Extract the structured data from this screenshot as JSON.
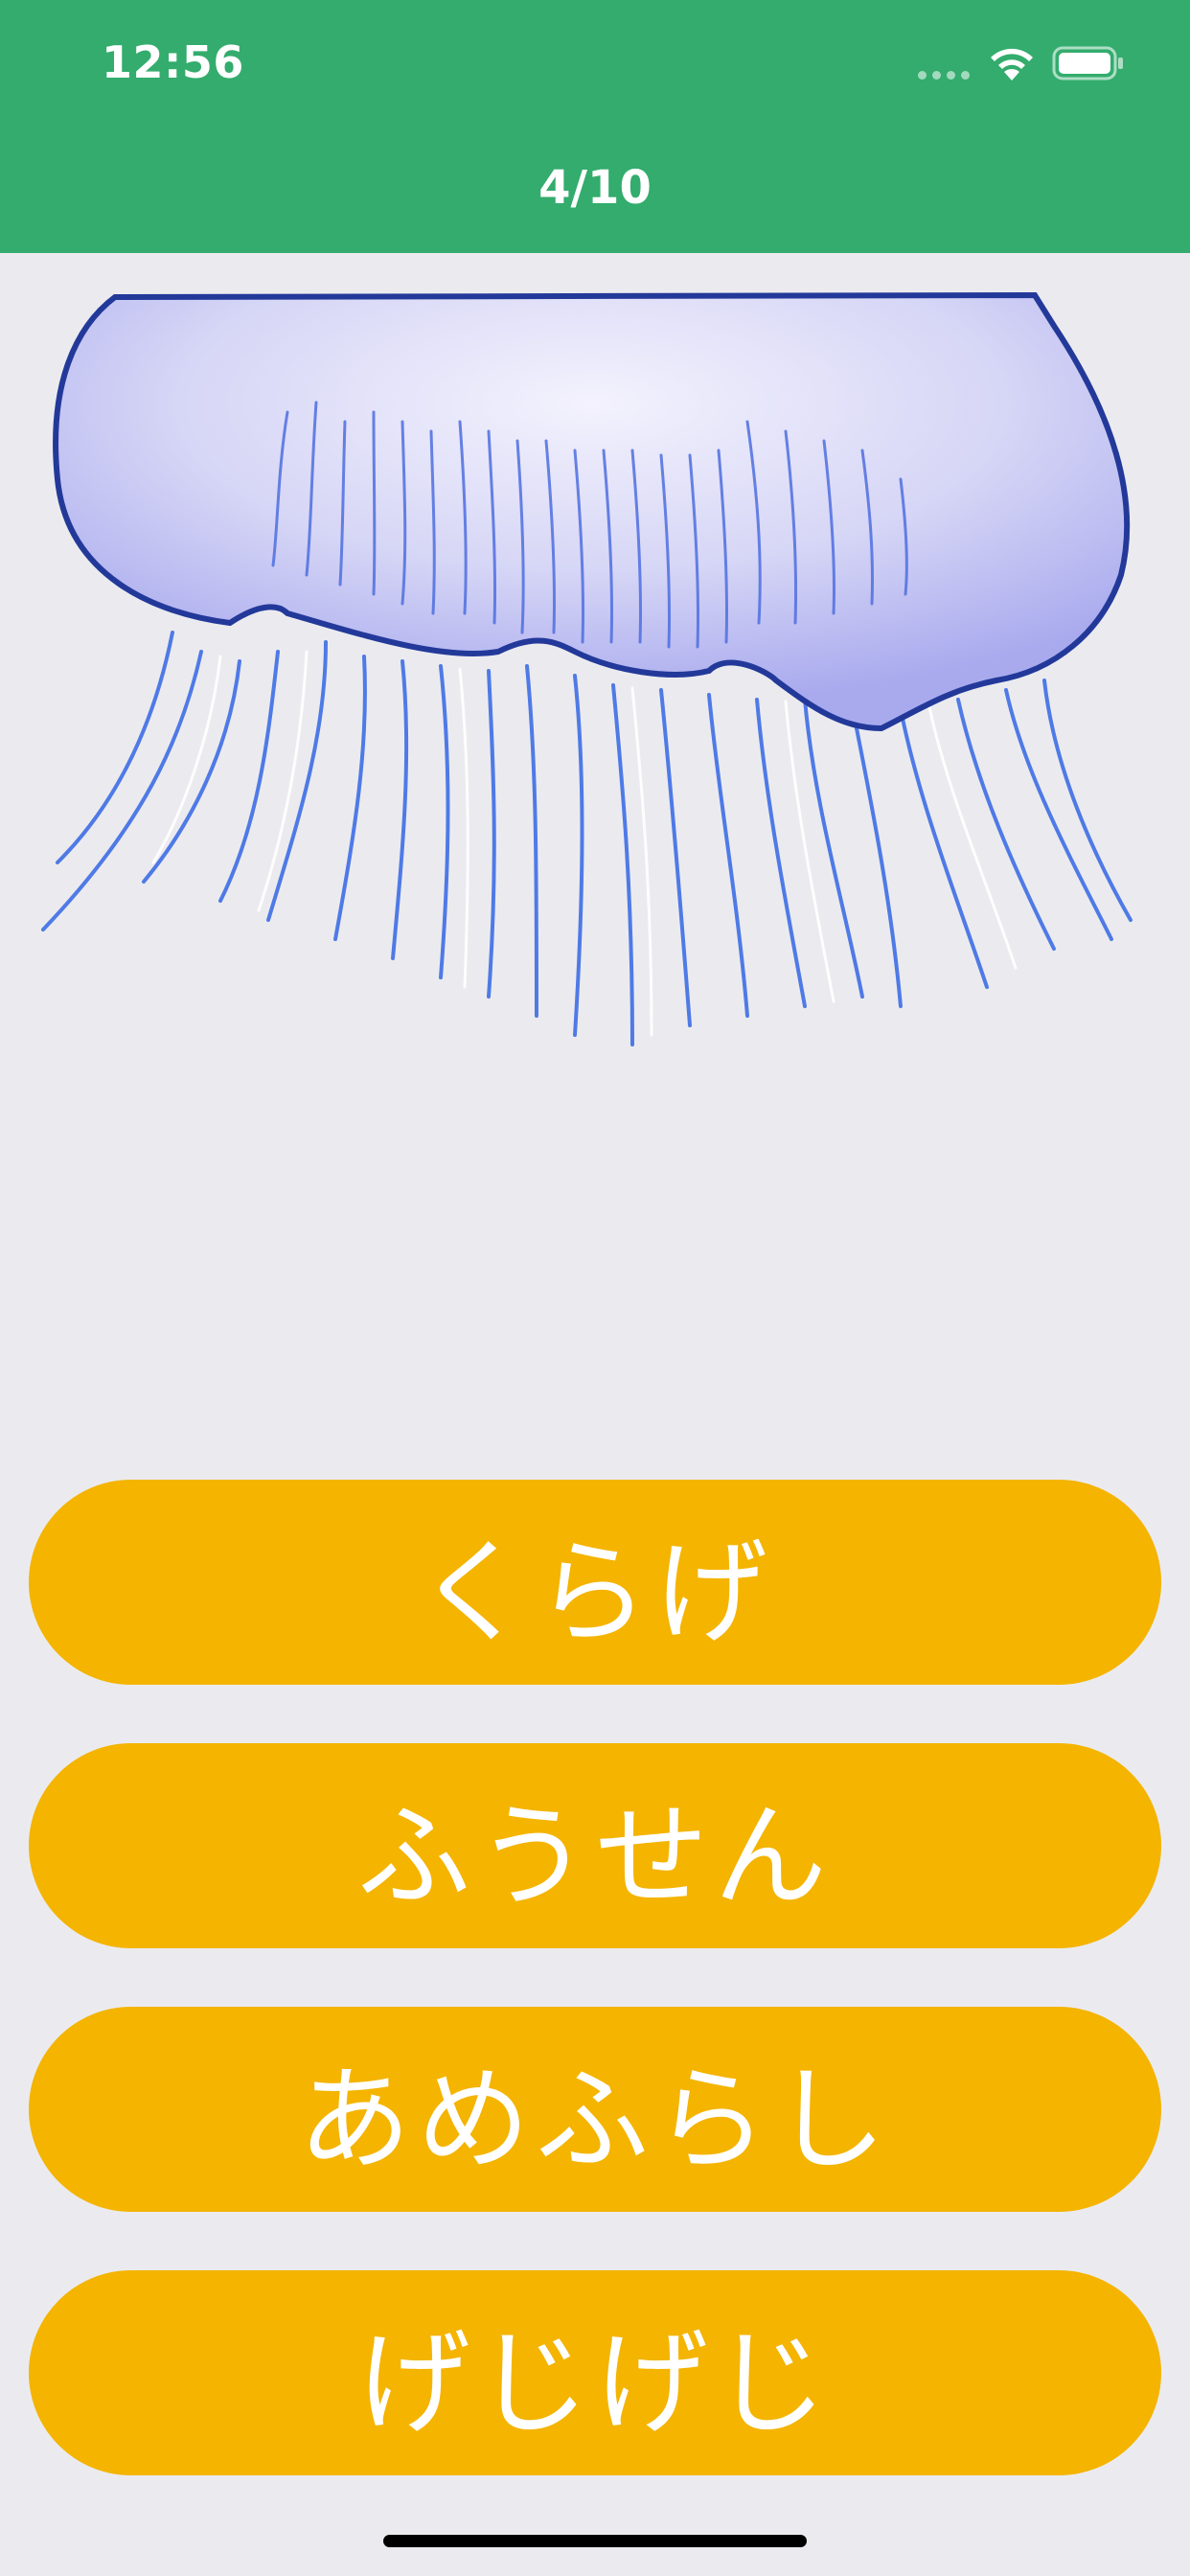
{
  "status_bar": {
    "time": "12:56",
    "icons": [
      "signal-dots-icon",
      "wifi-icon",
      "battery-icon"
    ]
  },
  "quiz": {
    "progress": "4/10",
    "image_subject_icon": "jellyfish-illustration"
  },
  "answers": [
    {
      "label": "くらげ"
    },
    {
      "label": "ふうせん"
    },
    {
      "label": "あめふらし"
    },
    {
      "label": "げじげじ"
    }
  ],
  "colors": {
    "header": "#33ac6d",
    "background": "#ebebef",
    "answer_button": "#f4b400",
    "answer_text": "#ffffff"
  }
}
